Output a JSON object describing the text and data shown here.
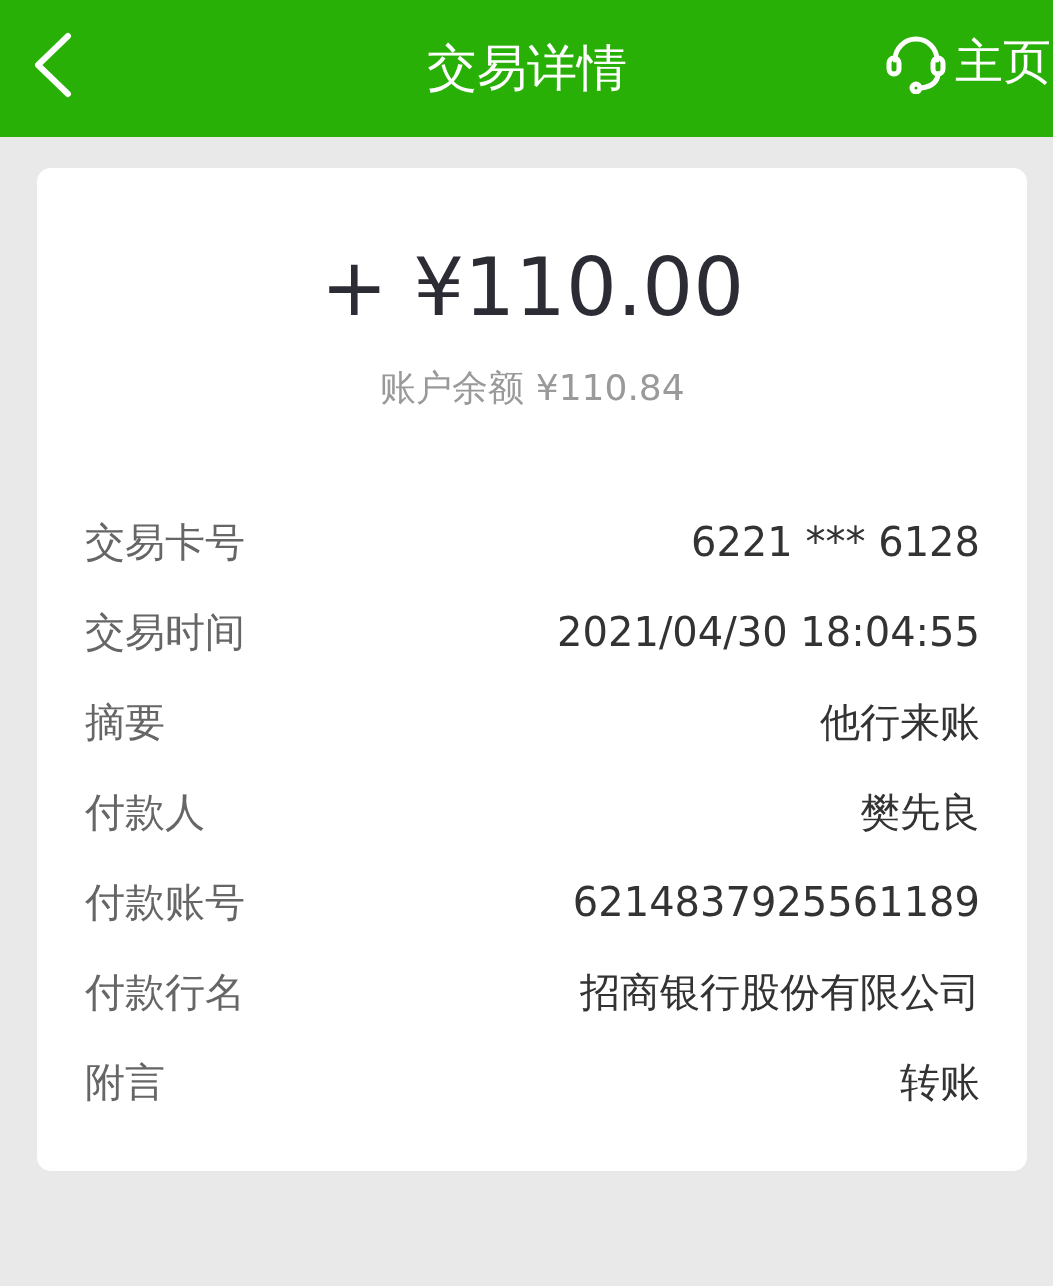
{
  "header": {
    "title": "交易详情",
    "home_label": "主页"
  },
  "summary": {
    "amount": "+ ¥110.00",
    "balance": "账户余额 ¥110.84"
  },
  "details": [
    {
      "label": "交易卡号",
      "value": "6221 *** 6128"
    },
    {
      "label": "交易时间",
      "value": "2021/04/30 18:04:55"
    },
    {
      "label": "摘要",
      "value": "他行来账"
    },
    {
      "label": "付款人",
      "value": "樊先良"
    },
    {
      "label": "付款账号",
      "value": "6214837925561189"
    },
    {
      "label": "付款行名",
      "value": "招商银行股份有限公司"
    },
    {
      "label": "附言",
      "value": "转账"
    }
  ]
}
